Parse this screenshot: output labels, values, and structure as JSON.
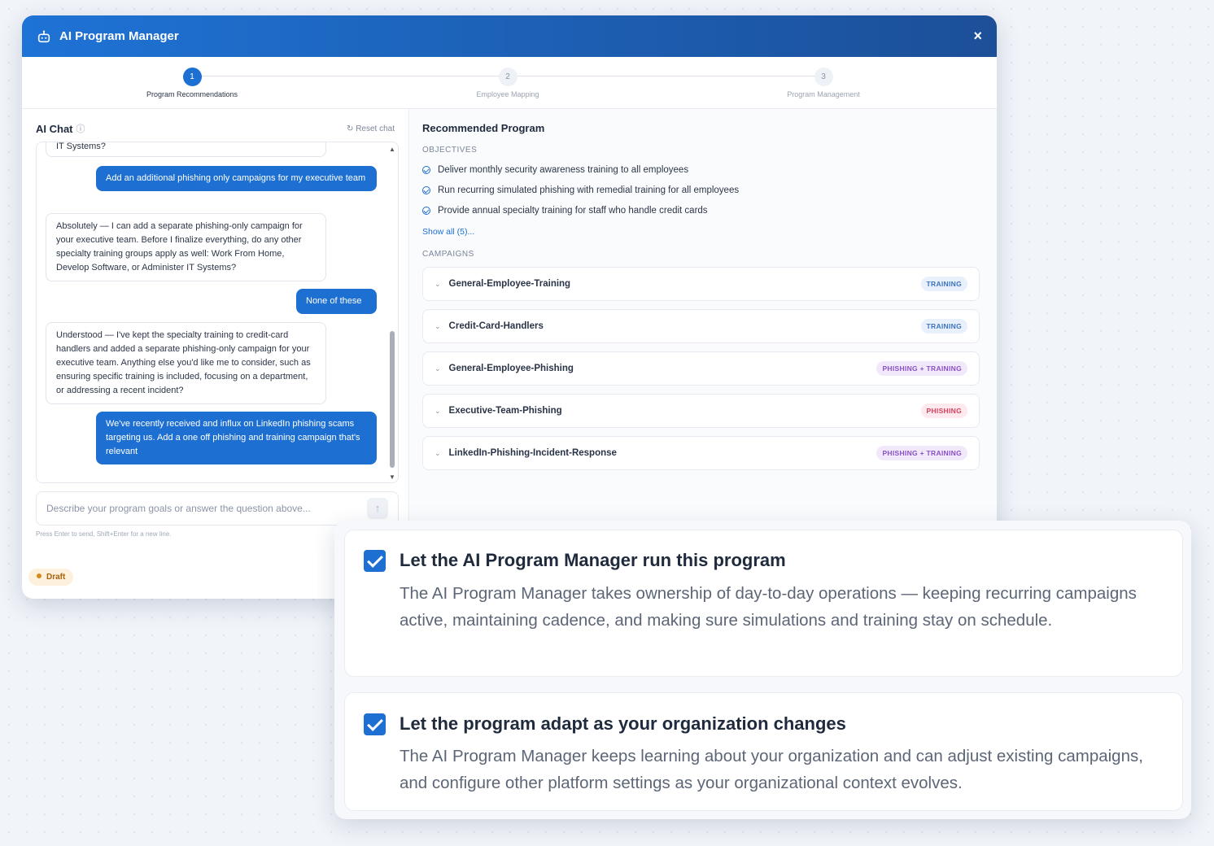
{
  "window": {
    "title": "AI Program Manager",
    "close": "×"
  },
  "stepper": [
    {
      "num": "1",
      "label": "Program Recommendations"
    },
    {
      "num": "2",
      "label": "Employee Mapping"
    },
    {
      "num": "3",
      "label": "Program Management"
    }
  ],
  "chat": {
    "title": "AI Chat",
    "info_icon": "ⓘ",
    "reset": "↻ Reset chat",
    "messages": [
      {
        "role": "ai",
        "text": "IT Systems?"
      },
      {
        "role": "user",
        "text": "Add an additional phishing only campaigns for my executive team"
      },
      {
        "role": "ai",
        "text": "Absolutely — I can add a separate phishing-only campaign for your executive team. Before I finalize everything, do any other specialty training groups apply as well: Work From Home, Develop Software, or Administer IT Systems?"
      },
      {
        "role": "user",
        "text": "None of these"
      },
      {
        "role": "ai",
        "text": "Understood — I've kept the specialty training to credit-card handlers and added a separate phishing-only campaign for your executive team. Anything else you'd like me to consider, such as ensuring specific training is included, focusing on a department, or addressing a recent incident?"
      },
      {
        "role": "user",
        "text": "We've recently received and influx on LinkedIn phishing scams targeting us. Add a one off phishing and training campaign that's relevant"
      }
    ],
    "input_placeholder": "Describe your program goals or answer the question above...",
    "send_icon": "↑",
    "hint": "Press Enter to send, Shift+Enter for a new line.",
    "status": "Draft"
  },
  "program": {
    "title": "Recommended Program",
    "objectives_label": "OBJECTIVES",
    "objectives": [
      "Deliver monthly security awareness training to all employees",
      "Run recurring simulated phishing with remedial training for all employees",
      "Provide annual specialty training for staff who handle credit cards"
    ],
    "show_all": "Show all (5)...",
    "campaigns_label": "CAMPAIGNS",
    "campaigns": [
      {
        "name": "General-Employee-Training",
        "tag": "TRAINING"
      },
      {
        "name": "Credit-Card-Handlers",
        "tag": "TRAINING"
      },
      {
        "name": "General-Employee-Phishing",
        "tag": "PHISHING + TRAINING"
      },
      {
        "name": "Executive-Team-Phishing",
        "tag": "PHISHING"
      },
      {
        "name": "LinkedIn-Phishing-Incident-Response",
        "tag": "PHISHING + TRAINING"
      }
    ]
  },
  "options": [
    {
      "checked": true,
      "title": "Let the AI Program Manager run this program",
      "description": "The AI Program Manager takes ownership of day-to-day operations — keeping recurring campaigns active, maintaining cadence, and making sure simulations and training stay on schedule."
    },
    {
      "checked": true,
      "title": "Let the program adapt as your organization changes",
      "description": "The AI Program Manager keeps learning about your organization and can adjust existing campaigns, and configure other platform settings as your organizational context evolves."
    }
  ]
}
